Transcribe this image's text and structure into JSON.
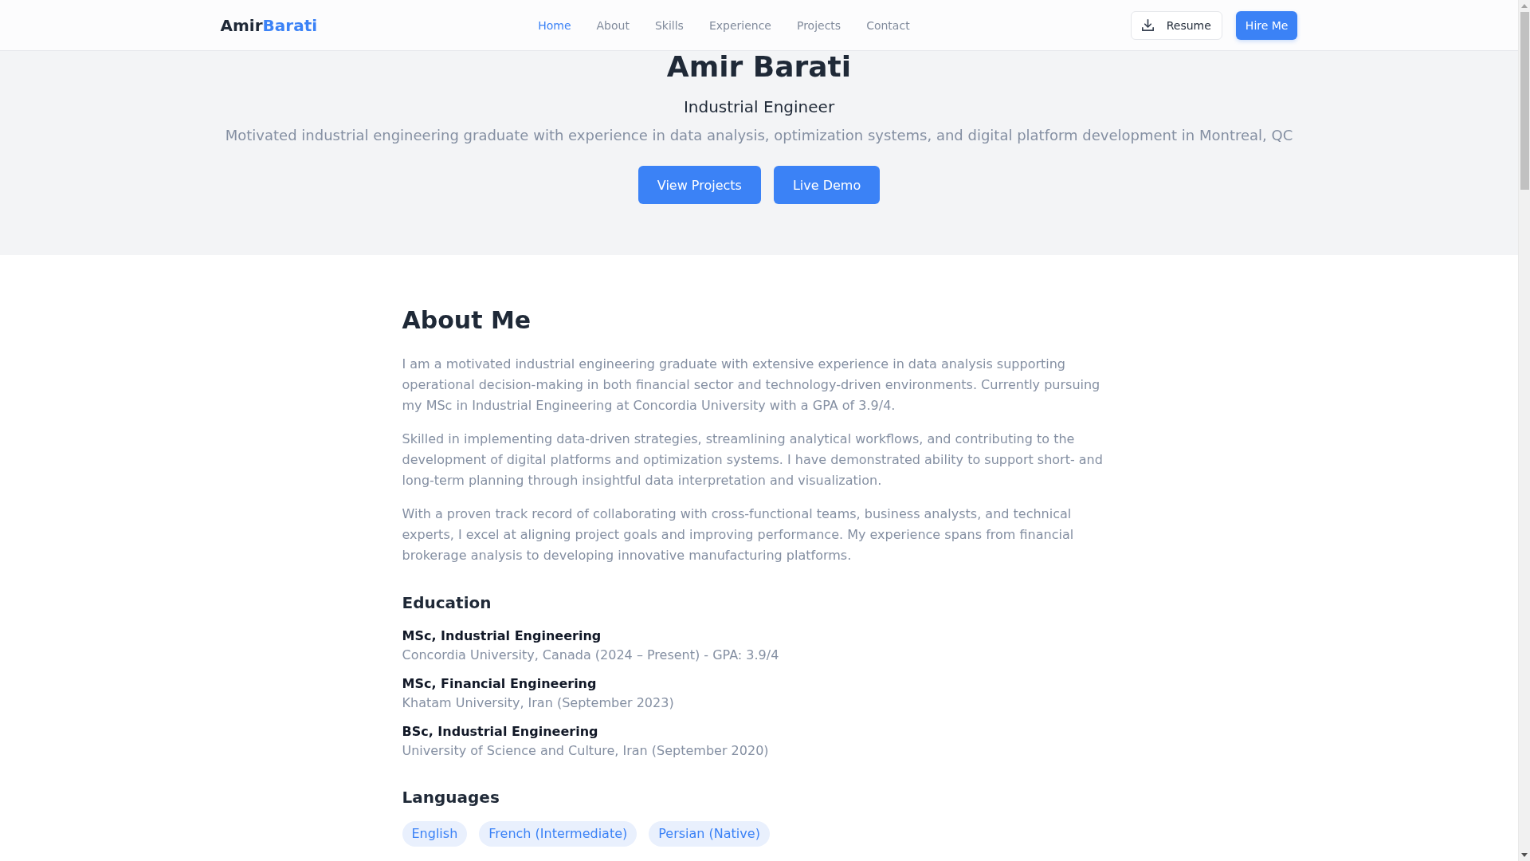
{
  "header": {
    "logo": {
      "first": "Amir",
      "accent": "Barati"
    },
    "nav": [
      {
        "label": "Home",
        "selected": true
      },
      {
        "label": "About",
        "selected": false
      },
      {
        "label": "Skills",
        "selected": false
      },
      {
        "label": "Experience",
        "selected": false
      },
      {
        "label": "Projects",
        "selected": false
      },
      {
        "label": "Contact",
        "selected": false
      }
    ],
    "actions": [
      {
        "kind": "download",
        "label": "Resume"
      },
      {
        "kind": "primary",
        "label": "Hire Me"
      }
    ]
  },
  "hero": {
    "name": "Amir Barati",
    "title": "Industrial Engineer",
    "summary": "Motivated industrial engineering graduate with experience in data analysis, optimization systems, and digital platform development in Montreal, QC",
    "buttons": [
      {
        "label": "View Projects"
      },
      {
        "label": "Live Demo"
      }
    ]
  },
  "about": {
    "heading": "About Me",
    "paragraphs": [
      "I am a motivated industrial engineering graduate with extensive experience in data analysis supporting operational decision-making in both financial sector and technology-driven environments. Currently pursuing my MSc in Industrial Engineering at Concordia University with a GPA of 3.9/4.",
      "Skilled in implementing data-driven strategies, streamlining analytical workflows, and contributing to the development of digital platforms and optimization systems. I have demonstrated ability to support short- and long-term planning through insightful data interpretation and visualization.",
      "With a proven track record of collaborating with cross-functional teams, business analysts, and technical experts, I excel at aligning project goals and improving performance. My experience spans from financial brokerage analysis to developing innovative manufacturing platforms."
    ],
    "education": {
      "heading": "Education",
      "items": [
        {
          "degree": "MSc, Industrial Engineering",
          "details": "Concordia University, Canada (2024 – Present) - GPA: 3.9/4"
        },
        {
          "degree": "MSc, Financial Engineering",
          "details": "Khatam University, Iran (September 2023)"
        },
        {
          "degree": "BSc, Industrial Engineering",
          "details": "University of Science and Culture, Iran (September 2020)"
        }
      ]
    },
    "languages": {
      "heading": "Languages",
      "items": [
        "English",
        "French (Intermediate)",
        "Persian (Native)"
      ]
    }
  }
}
